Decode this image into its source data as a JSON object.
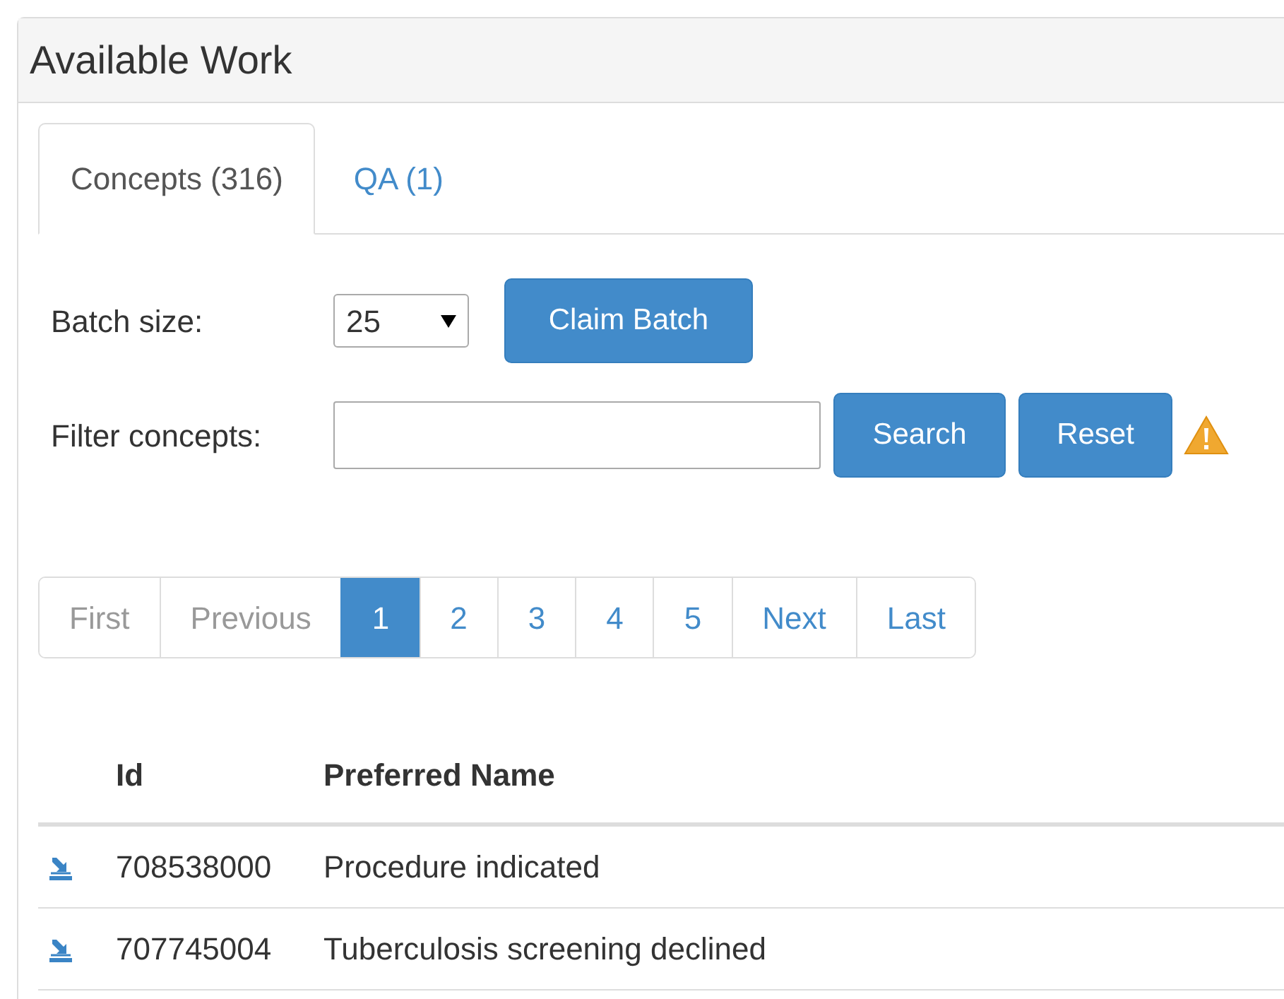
{
  "panel": {
    "title": "Available Work"
  },
  "tabs": [
    {
      "label": "Concepts (316)",
      "selected": true
    },
    {
      "label": "QA (1)",
      "selected": false
    }
  ],
  "batch": {
    "label": "Batch size:",
    "value": "25",
    "button": "Claim Batch"
  },
  "filter": {
    "label": "Filter concepts:",
    "buttons": [
      "Search",
      "Reset"
    ]
  },
  "pagination": [
    {
      "label": "First",
      "selected": false,
      "disabled": true
    },
    {
      "label": "Previous",
      "selected": false,
      "disabled": true
    },
    {
      "label": "1",
      "selected": true,
      "disabled": false
    },
    {
      "label": "2",
      "selected": false,
      "disabled": false
    },
    {
      "label": "3",
      "selected": false,
      "disabled": false
    },
    {
      "label": "4",
      "selected": false,
      "disabled": false
    },
    {
      "label": "5",
      "selected": false,
      "disabled": false
    },
    {
      "label": "Next",
      "selected": false,
      "disabled": false
    },
    {
      "label": "Last",
      "selected": false,
      "disabled": false
    }
  ],
  "table": {
    "columns": [
      "Id",
      "Preferred Name"
    ],
    "rows": [
      {
        "id": "708538000",
        "name": "Procedure indicated"
      },
      {
        "id": "707745004",
        "name": "Tuberculosis screening declined"
      }
    ]
  }
}
